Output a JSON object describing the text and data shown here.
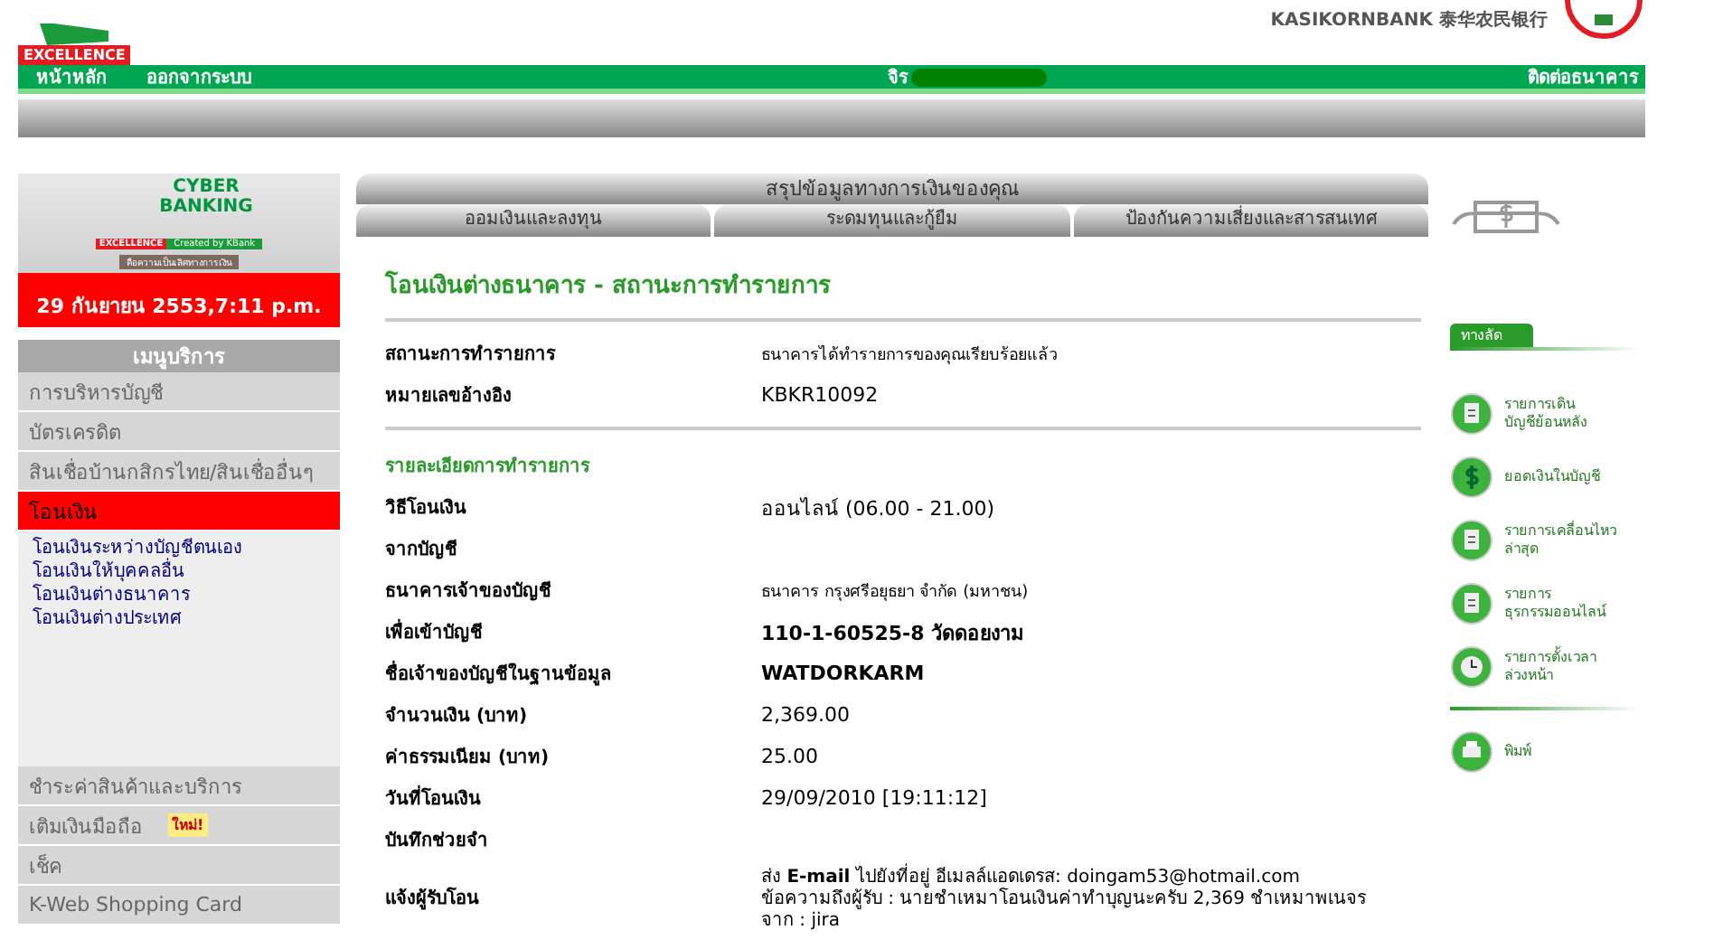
{
  "header": {
    "brand_badge": "EXCELLENCE",
    "bank_name": "KASIKORNBANK 泰华农民银行",
    "nav": [
      "หน้าหลัก",
      "ออกจากระบบ"
    ],
    "user": "จิร",
    "contact": "ติดต่อธนาคาร"
  },
  "sidebar": {
    "logo": {
      "line1": "CYBER",
      "line2": "BANKING",
      "badge": "EXCELLENCE",
      "badge_note": "Created by KBank",
      "tagline": "คือความเป็นเลิศทางการเงิน"
    },
    "date": "29 กันยายน 2553,7:11 p.m.",
    "menu_title": "เมนูบริการ",
    "items": [
      {
        "label": "การบริหารบัญชี",
        "selected": false
      },
      {
        "label": "บัตรเครดิต",
        "selected": false
      },
      {
        "label": "สินเชื่อบ้านกสิกรไทย/สินเชื่ออื่นๆ",
        "selected": false
      },
      {
        "label": "โอนเงิน",
        "selected": true,
        "children": [
          "โอนเงินระหว่างบัญชีตนเอง",
          "โอนเงินให้บุคคลอื่น",
          "โอนเงินต่างธนาคาร",
          "โอนเงินต่างประเทศ"
        ]
      },
      {
        "label": "ชำระค่าสินค้าและบริการ",
        "selected": false
      },
      {
        "label": "เติมเงินมือถือ",
        "selected": false,
        "badge": "ใหม่!"
      },
      {
        "label": "เช็ค",
        "selected": false
      },
      {
        "label": "K-Web Shopping Card",
        "selected": false
      }
    ]
  },
  "tabs": {
    "top": "สรุปข้อมูลทางการเงินของคุณ",
    "items": [
      "ออมเงินและลงทุน",
      "ระดมทุนและกู้ยืม",
      "ป้องกันความเสี่ยงและสารสนเทศ"
    ]
  },
  "main": {
    "title": "โอนเงินต่างธนาคาร - สถานะการทำรายการ",
    "status_rows": [
      {
        "label": "สถานะการทำรายการ",
        "value": "ธนาคารได้ทำรายการของคุณเรียบร้อยแล้ว",
        "kind": "small"
      },
      {
        "label": "หมายเลขอ้างอิง",
        "value": "KBKR10092",
        "kind": "plain"
      }
    ],
    "section": "รายละเอียดการทำรายการ",
    "detail_rows": [
      {
        "label": "วิธีโอนเงิน",
        "value": "ออนไลน์ (06.00 - 21.00)",
        "kind": "plain"
      },
      {
        "label": "จากบัญชี",
        "kind": "plain"
      },
      {
        "label": "ธนาคารเจ้าของบัญชี",
        "value": "ธนาคาร กรุงศรีอยุธยา จำกัด (มหาชน)",
        "kind": "small"
      },
      {
        "label": "เพื่อเข้าบัญชี",
        "value": "110-1-60525-8 วัดดอยงาม",
        "kind": "bold"
      },
      {
        "label": "ชื่อเจ้าของบัญชีในฐานข้อมูล",
        "value": "WATDORKARM",
        "kind": "bold"
      },
      {
        "label": "จำนวนเงิน (บาท)",
        "value": "2,369.00",
        "kind": "plain"
      },
      {
        "label": "ค่าธรรมเนียม (บาท)",
        "value": "25.00",
        "kind": "plain"
      },
      {
        "label": "วันที่โอนเงิน",
        "value": "29/09/2010 [19:11:12]",
        "kind": "plain"
      },
      {
        "label": "บันทึกช่วยจำ",
        "kind": "plain"
      },
      {
        "label": "แจ้งผู้รับโอน",
        "kind": "lines",
        "lines": [
          "ส่ง **E-mail** ไปยังที่อยู่ อีเมลล์แอดเดรส: doingam53@hotmail.com",
          "ข้อความถึงผู้รับ : นายชำเหมาโอนเงินค่าทำบุญนะครับ 2,369 ชำเหมาพเนจร",
          "จาก : jira"
        ]
      }
    ]
  },
  "shortcuts": {
    "title": "ทางลัด",
    "items": [
      {
        "kind": "document",
        "lines": [
          "รายการเดิน",
          "บัญชีย้อนหลัง"
        ]
      },
      {
        "kind": "dollar",
        "lines": [
          "ยอดเงินในบัญชี"
        ]
      },
      {
        "kind": "document",
        "lines": [
          "รายการเคลื่อนไหว",
          "ล่าสุด"
        ]
      },
      {
        "kind": "document",
        "lines": [
          "รายการ",
          "ธุรกรรมออนไลน์"
        ]
      },
      {
        "kind": "clock",
        "lines": [
          "รายการตั้งเวลา",
          "ล่วงหน้า"
        ]
      }
    ],
    "print": "พิมพ์"
  }
}
